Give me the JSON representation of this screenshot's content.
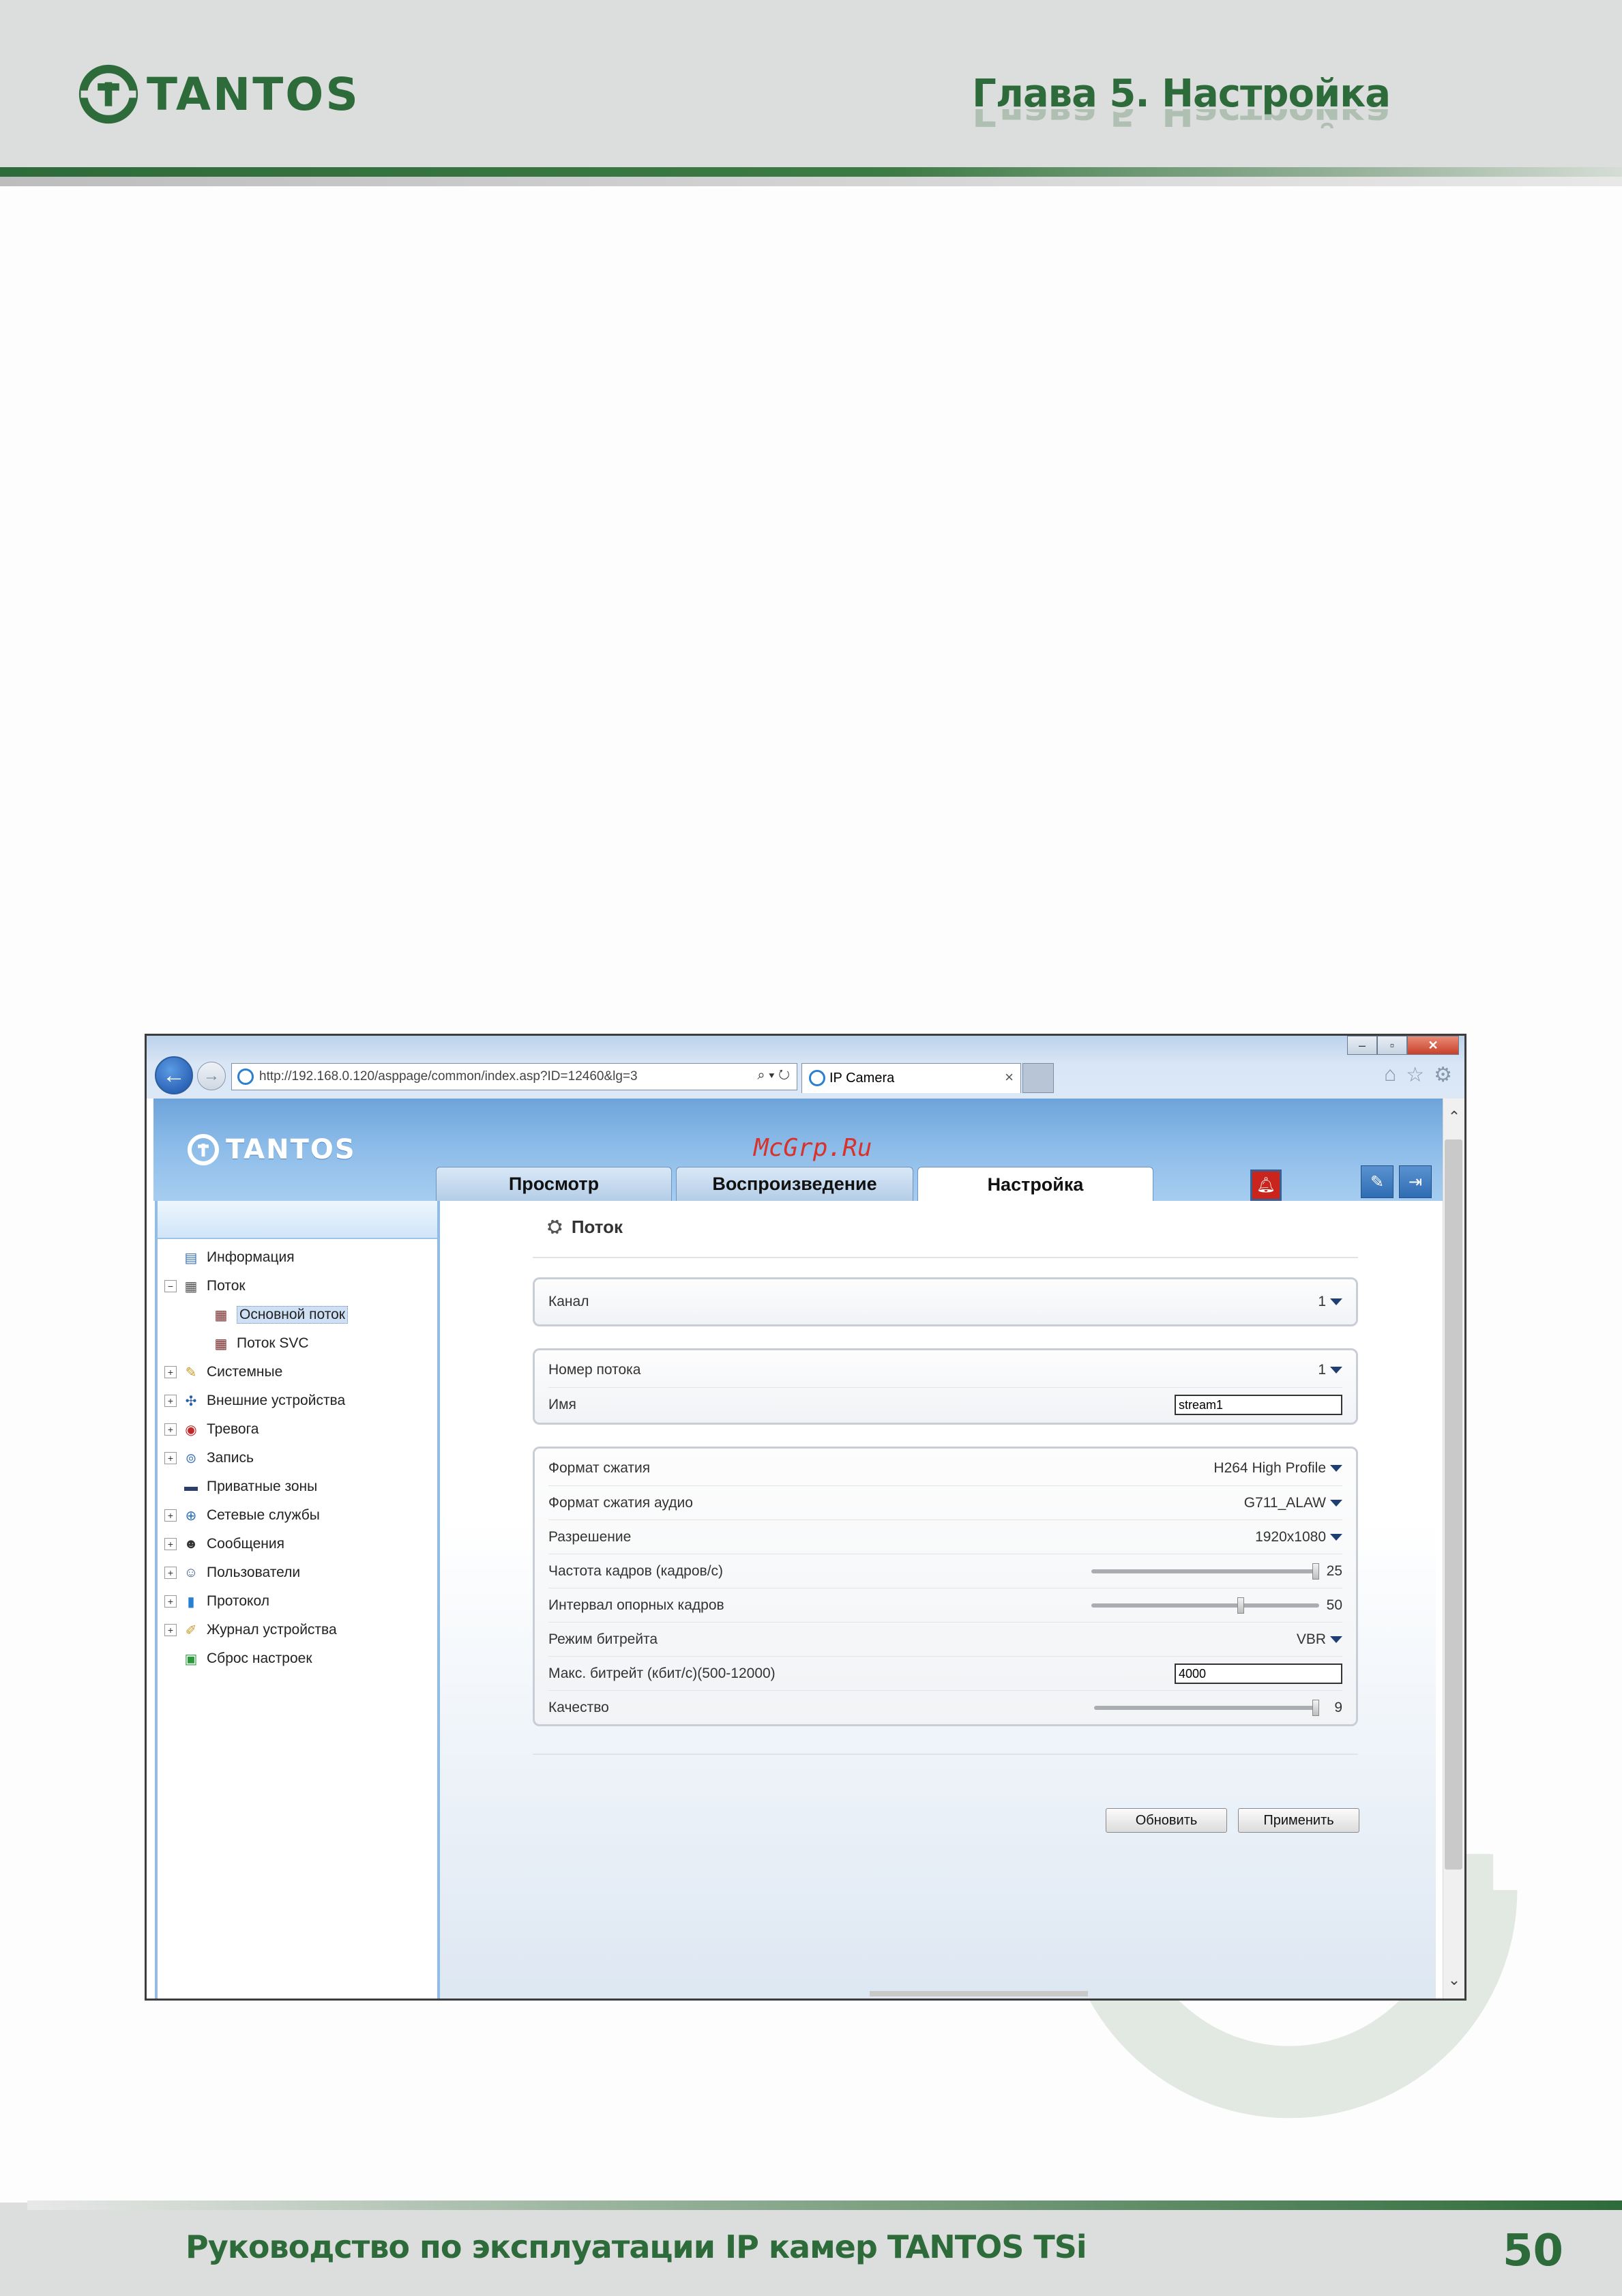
{
  "page_header": {
    "brand": "TANTOS",
    "chapter_title": "Глава 5. Настройка"
  },
  "page_footer": {
    "manual_title": "Руководство по эксплуатации IP камер TANTOS TSi",
    "page_number": "50"
  },
  "browser": {
    "url": "http://192.168.0.120/asppage/common/index.asp?ID=12460&lg=3",
    "tab_title": "IP Camera",
    "tab_close": "×",
    "window_buttons": [
      "–",
      "▫",
      "✕"
    ]
  },
  "app": {
    "brand": "TANTOS",
    "watermark": "McGrp.Ru",
    "tabs": [
      {
        "label": "Просмотр",
        "active": false
      },
      {
        "label": "Воспроизведение",
        "active": false
      },
      {
        "label": "Настройка",
        "active": true
      }
    ],
    "tree": [
      {
        "label": "Информация",
        "icon": "info-icon",
        "expandable": false
      },
      {
        "label": "Поток",
        "icon": "stream-icon",
        "expandable": true,
        "expanded": true
      },
      {
        "label": "Основной поток",
        "icon": "stream-sub-icon",
        "child": true,
        "selected": true
      },
      {
        "label": "Поток SVC",
        "icon": "stream-sub-icon",
        "child": true
      },
      {
        "label": "Системные",
        "icon": "system-icon",
        "expandable": true
      },
      {
        "label": "Внешние устройства",
        "icon": "external-device-icon",
        "expandable": true
      },
      {
        "label": "Тревога",
        "icon": "alarm-icon",
        "expandable": true
      },
      {
        "label": "Запись",
        "icon": "record-icon",
        "expandable": true
      },
      {
        "label": "Приватные зоны",
        "icon": "privacy-icon",
        "expandable": false
      },
      {
        "label": "Сетевые службы",
        "icon": "network-icon",
        "expandable": true
      },
      {
        "label": "Сообщения",
        "icon": "message-icon",
        "expandable": true
      },
      {
        "label": "Пользователи",
        "icon": "users-icon",
        "expandable": true
      },
      {
        "label": "Протокол",
        "icon": "protocol-icon",
        "expandable": true
      },
      {
        "label": "Журнал устройства",
        "icon": "log-icon",
        "expandable": true
      },
      {
        "label": "Сброс настроек",
        "icon": "reset-icon",
        "expandable": false
      }
    ],
    "section_title": "Поток",
    "channel": {
      "label": "Канал",
      "value": "1"
    },
    "stream": {
      "number_label": "Номер потока",
      "number_value": "1",
      "name_label": "Имя",
      "name_value": "stream1"
    },
    "encoding": {
      "compression_label": "Формат сжатия",
      "compression_value": "H264 High Profile",
      "audio_label": "Формат сжатия аудио",
      "audio_value": "G711_ALAW",
      "resolution_label": "Разрешение",
      "resolution_value": "1920x1080",
      "fps_label": "Частота кадров (кадров/с)",
      "fps_value": "25",
      "fps_fraction": 1.0,
      "gop_label": "Интервал опорных кадров",
      "gop_value": "50",
      "gop_fraction": 0.66,
      "bitrate_mode_label": "Режим битрейта",
      "bitrate_mode_value": "VBR",
      "max_bitrate_label": "Макс. битрейт (кбит/с)(500-12000)",
      "max_bitrate_value": "4000",
      "quality_label": "Качество",
      "quality_value": "9",
      "quality_fraction": 1.0
    },
    "buttons": {
      "refresh": "Обновить",
      "apply": "Применить"
    }
  }
}
